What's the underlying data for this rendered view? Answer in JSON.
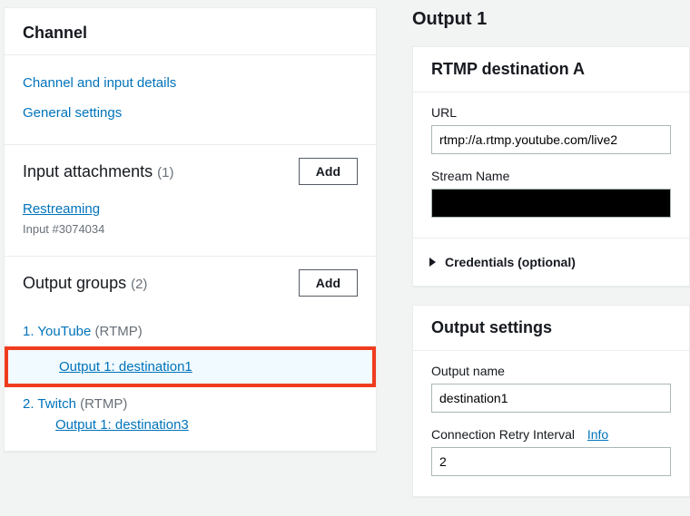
{
  "sidebar": {
    "title": "Channel",
    "channel_details_link": "Channel and input details",
    "general_settings_link": "General settings",
    "input_attachments": {
      "title": "Input attachments",
      "count": "(1)",
      "add_label": "Add",
      "items": [
        {
          "name": "Restreaming",
          "note": "Input #3074034"
        }
      ]
    },
    "output_groups": {
      "title": "Output groups",
      "count": "(2)",
      "add_label": "Add",
      "groups": [
        {
          "index": "1.",
          "name": "YouTube",
          "proto": "(RTMP)",
          "outputs": [
            {
              "label": "Output 1: destination1",
              "selected": true
            }
          ]
        },
        {
          "index": "2.",
          "name": "Twitch",
          "proto": "(RTMP)",
          "outputs": [
            {
              "label": "Output 1: destination3",
              "selected": false
            }
          ]
        }
      ]
    }
  },
  "main": {
    "title": "Output 1",
    "destination": {
      "title": "RTMP destination A",
      "url_label": "URL",
      "url_value": "rtmp://a.rtmp.youtube.com/live2",
      "stream_label": "Stream Name",
      "stream_value": "",
      "credentials_label": "Credentials (optional)"
    },
    "settings": {
      "title": "Output settings",
      "name_label": "Output name",
      "name_value": "destination1",
      "retry_label": "Connection Retry Interval",
      "retry_info": "Info",
      "retry_value": "2"
    }
  }
}
